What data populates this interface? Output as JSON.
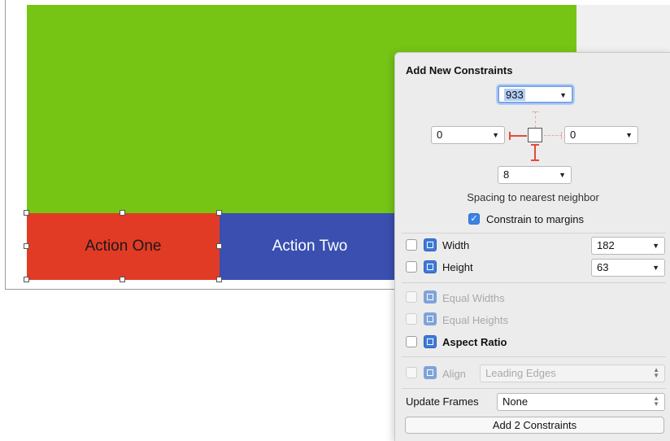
{
  "canvas": {
    "action_one_label": "Action One",
    "action_two_label": "Action Two",
    "colors": {
      "green": "#76c515",
      "red": "#e23b25",
      "blue": "#3a4fb0"
    }
  },
  "popover": {
    "title": "Add New Constraints",
    "top_value": "933",
    "left_value": "0",
    "right_value": "0",
    "bottom_value": "8",
    "spacing_caption": "Spacing to nearest neighbor",
    "constrain_margins": {
      "label": "Constrain to margins",
      "checked": true
    },
    "width": {
      "label": "Width",
      "value": "182",
      "checked": false
    },
    "height": {
      "label": "Height",
      "value": "63",
      "checked": false
    },
    "equal_widths": {
      "label": "Equal Widths",
      "enabled": false
    },
    "equal_heights": {
      "label": "Equal Heights",
      "enabled": false
    },
    "aspect_ratio": {
      "label": "Aspect Ratio",
      "checked": false
    },
    "align": {
      "label": "Align",
      "value": "Leading Edges",
      "enabled": false
    },
    "update_frames": {
      "label": "Update Frames",
      "value": "None"
    },
    "add_button_label": "Add 2 Constraints"
  },
  "icons": {
    "dropdown": "chevron-down-icon",
    "checkmark": "checkmark-icon",
    "width": "width-constraint-icon",
    "height": "height-constraint-icon",
    "stepper": "up-down-stepper-icon"
  }
}
